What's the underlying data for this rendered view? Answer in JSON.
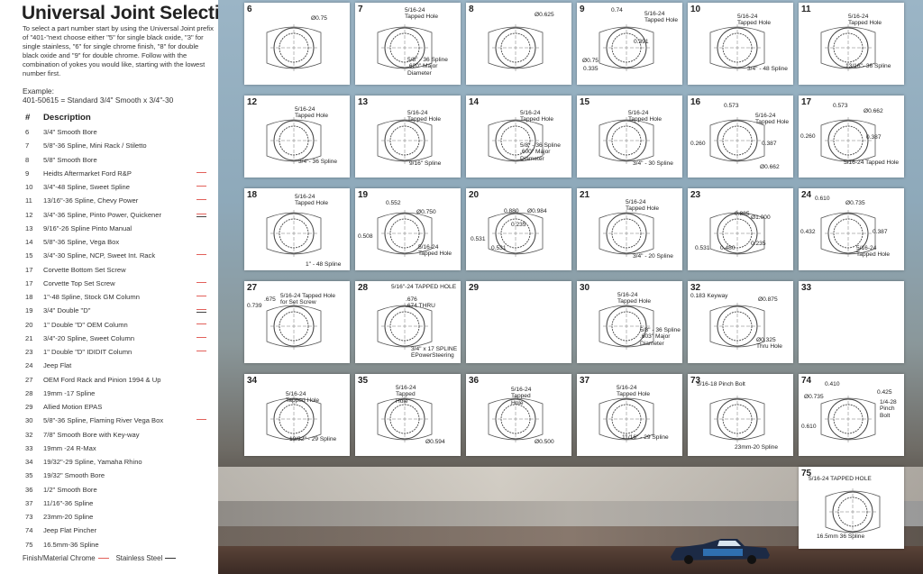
{
  "title": "Universal Joint Selection",
  "intro": "To select a part number start by using the Universal Joint prefix of \"401-\"next choose either \"5\" for single black oxide, \"3\" for single stainless, \"6\" for single chrome finish, \"8\" for double black oxide and \"9\" for double chrome. Follow with the combination of yokes you would like, starting with the lowest number first.",
  "example_label": "Example:",
  "example_value": "401-50615 = Standard 3/4\" Smooth x 3/4\"-30",
  "table_headers": {
    "num": "#",
    "desc": "Description"
  },
  "rows": [
    {
      "num": "6",
      "desc": "3/4\" Smooth Bore",
      "finish": ""
    },
    {
      "num": "7",
      "desc": "5/8\"-36 Spline, Mini Rack / Stiletto",
      "finish": ""
    },
    {
      "num": "8",
      "desc": "5/8\" Smooth Bore",
      "finish": ""
    },
    {
      "num": "9",
      "desc": "Heidts Aftermarket Ford R&P",
      "finish": "chrome"
    },
    {
      "num": "10",
      "desc": "3/4\"-48 Spline, Sweet Spline",
      "finish": "chrome"
    },
    {
      "num": "11",
      "desc": "13/16\"-36 Spline, Chevy Power",
      "finish": "chrome"
    },
    {
      "num": "12",
      "desc": "3/4\"-36 Spline, Pinto Power, Quickener",
      "finish": "both"
    },
    {
      "num": "13",
      "desc": "9/16\"-26 Spline Pinto Manual",
      "finish": ""
    },
    {
      "num": "14",
      "desc": "5/8\"-36 Spline, Vega Box",
      "finish": ""
    },
    {
      "num": "15",
      "desc": "3/4\"-30 Spline, NCP, Sweet Int. Rack",
      "finish": "chrome"
    },
    {
      "num": "17",
      "desc": "Corvette Bottom Set Screw",
      "finish": ""
    },
    {
      "num": "17",
      "desc": "Corvette Top Set Screw",
      "finish": "chrome"
    },
    {
      "num": "18",
      "desc": "1\"-48 Spline, Stock GM Column",
      "finish": "chrome"
    },
    {
      "num": "19",
      "desc": "3/4\" Double \"D\"",
      "finish": "both"
    },
    {
      "num": "20",
      "desc": "1\" Double \"D\" OEM Column",
      "finish": "chrome"
    },
    {
      "num": "21",
      "desc": "3/4\"-20 Spline, Sweet Column",
      "finish": "chrome"
    },
    {
      "num": "23",
      "desc": "1\" Double \"D\" IDIDIT Column",
      "finish": "chrome"
    },
    {
      "num": "24",
      "desc": "Jeep Flat",
      "finish": ""
    },
    {
      "num": "27",
      "desc": "OEM Ford Rack and Pinion 1994 & Up",
      "finish": ""
    },
    {
      "num": "28",
      "desc": "19mm -17 Spline",
      "finish": ""
    },
    {
      "num": "29",
      "desc": "Allied Motion EPAS",
      "finish": ""
    },
    {
      "num": "30",
      "desc": "5/8\"-36 Spline, Flaming River Vega Box",
      "finish": "chrome"
    },
    {
      "num": "32",
      "desc": "7/8\" Smooth Bore with Key-way",
      "finish": ""
    },
    {
      "num": "33",
      "desc": "19mm -24 R-Max",
      "finish": ""
    },
    {
      "num": "34",
      "desc": "19/32\"-29 Spline, Yamaha Rhino",
      "finish": ""
    },
    {
      "num": "35",
      "desc": "19/32\" Smooth Bore",
      "finish": ""
    },
    {
      "num": "36",
      "desc": "1/2\" Smooth Bore",
      "finish": ""
    },
    {
      "num": "37",
      "desc": "11/16\"-36 Spline",
      "finish": ""
    },
    {
      "num": "73",
      "desc": "23mm-20 Spline",
      "finish": ""
    },
    {
      "num": "74",
      "desc": "Jeep Flat Pincher",
      "finish": ""
    },
    {
      "num": "75",
      "desc": "16.5mm-36 Spline",
      "finish": ""
    }
  ],
  "legend": {
    "label": "Finish/Material",
    "chrome": "Chrome",
    "stainless": "Stainless Steel"
  },
  "colors": {
    "chrome": "#e2605a",
    "stainless": "#444444"
  },
  "cards": [
    {
      "num": "6",
      "notes": [
        {
          "t": "Ø0.75"
        }
      ]
    },
    {
      "num": "7",
      "notes": [
        {
          "t": "5/16-24\nTapped Hole"
        },
        {
          "t": "5/8\" - 36 Spline\n.620\" Major\nDiameter"
        }
      ]
    },
    {
      "num": "8",
      "notes": [
        {
          "t": "Ø0.625"
        }
      ]
    },
    {
      "num": "9",
      "notes": [
        {
          "t": "0.74"
        },
        {
          "t": "5/16-24\nTapped Hole"
        },
        {
          "t": "0.391"
        },
        {
          "t": "Ø0.75"
        },
        {
          "t": "0.335"
        }
      ]
    },
    {
      "num": "10",
      "notes": [
        {
          "t": "5/16-24\nTapped Hole"
        },
        {
          "t": "3/4\" - 48 Spline"
        }
      ]
    },
    {
      "num": "11",
      "notes": [
        {
          "t": "5/16-24\nTapped Hole"
        },
        {
          "t": "13/16\"- 36 Spline"
        }
      ]
    },
    {
      "num": "12",
      "notes": [
        {
          "t": "5/16-24\nTapped Hole"
        },
        {
          "t": "3/4\"- 36 Spline"
        }
      ]
    },
    {
      "num": "13",
      "notes": [
        {
          "t": "5/16-24\nTapped Hole"
        },
        {
          "t": "9/16\" Spline"
        }
      ]
    },
    {
      "num": "14",
      "notes": [
        {
          "t": "5/16-24\nTapped Hole"
        },
        {
          "t": "5/8\" - 36 Spline\n.600\" Major\nDiameter"
        }
      ]
    },
    {
      "num": "15",
      "notes": [
        {
          "t": "5/16-24\nTapped Hole"
        },
        {
          "t": "3/4\" - 30 Spline"
        }
      ]
    },
    {
      "num": "16",
      "notes": [
        {
          "t": "0.573"
        },
        {
          "t": "5/16-24\nTapped Hole"
        },
        {
          "t": "0.260"
        },
        {
          "t": "0.387"
        },
        {
          "t": "Ø0.662"
        }
      ]
    },
    {
      "num": "17",
      "notes": [
        {
          "t": "0.573"
        },
        {
          "t": "Ø0.662"
        },
        {
          "t": "0.260"
        },
        {
          "t": "0.387"
        },
        {
          "t": "5/16-24 Tapped Hole"
        }
      ]
    },
    {
      "num": "18",
      "notes": [
        {
          "t": "5/16-24\nTapped Hole"
        },
        {
          "t": "1\" - 48 Spline"
        }
      ]
    },
    {
      "num": "19",
      "notes": [
        {
          "t": "0.552"
        },
        {
          "t": "Ø0.750"
        },
        {
          "t": "0.508"
        },
        {
          "t": "5/16-24\nTapped Hole"
        }
      ]
    },
    {
      "num": "20",
      "notes": [
        {
          "t": "0.880"
        },
        {
          "t": "Ø0.984"
        },
        {
          "t": "0.235"
        },
        {
          "t": "0.531"
        },
        {
          "t": "0.531"
        }
      ]
    },
    {
      "num": "21",
      "notes": [
        {
          "t": "5/16-24\nTapped Hole"
        },
        {
          "t": "3/4\" - 20 Spline"
        }
      ]
    },
    {
      "num": "23",
      "notes": [
        {
          "t": "0.885"
        },
        {
          "t": "Ø1.000"
        },
        {
          "t": "0.235"
        },
        {
          "t": "0.531"
        },
        {
          "t": "0.480"
        }
      ]
    },
    {
      "num": "24",
      "notes": [
        {
          "t": "0.610"
        },
        {
          "t": "Ø0.735"
        },
        {
          "t": "0.432"
        },
        {
          "t": "0.387"
        },
        {
          "t": "5/16-24\nTapped Hole"
        }
      ]
    },
    {
      "num": "27",
      "notes": [
        {
          "t": ".675"
        },
        {
          "t": "5/16-24 Tapped Hole\nfor Set Screw"
        },
        {
          "t": "0.739"
        }
      ]
    },
    {
      "num": "28",
      "notes": [
        {
          "t": "5/16\"-24 TAPPED HOLE"
        },
        {
          "t": ".676\n.674 THRU"
        },
        {
          "t": "3/4\" x 17 SPLINE\nEPowerSteering"
        }
      ]
    },
    {
      "num": "29",
      "notes": []
    },
    {
      "num": "30",
      "notes": [
        {
          "t": "5/16-24\nTapped Hole"
        },
        {
          "t": "5/8\" - 36 Spline\n.603\" Major\nDiameter"
        }
      ]
    },
    {
      "num": "32",
      "notes": [
        {
          "t": "0.183 Keyway"
        },
        {
          "t": "Ø0.875"
        },
        {
          "t": "Ø0.325\nThru Hole"
        }
      ]
    },
    {
      "num": "33",
      "notes": []
    },
    {
      "num": "34",
      "notes": [
        {
          "t": "5/16-24\nTapped Hole"
        },
        {
          "t": "19/32\" - 29 Spline"
        }
      ]
    },
    {
      "num": "35",
      "notes": [
        {
          "t": "5/16-24\nTapped\nHole"
        },
        {
          "t": "Ø0.594"
        }
      ]
    },
    {
      "num": "36",
      "notes": [
        {
          "t": "5/16-24\nTapped\nHole"
        },
        {
          "t": "Ø0.500"
        }
      ]
    },
    {
      "num": "37",
      "notes": [
        {
          "t": "5/16-24\nTapped Hole"
        },
        {
          "t": "11/16\" - 29 Spline"
        }
      ]
    },
    {
      "num": "73",
      "notes": [
        {
          "t": "5/16-18 Pinch Bolt"
        },
        {
          "t": "23mm-20 Spline"
        }
      ]
    },
    {
      "num": "74",
      "notes": [
        {
          "t": "0.410"
        },
        {
          "t": "Ø0.735"
        },
        {
          "t": "0.425"
        },
        {
          "t": "1/4-28\nPinch\nBolt"
        },
        {
          "t": "0.610"
        }
      ]
    },
    {
      "num": "75",
      "notes": [
        {
          "t": "5/16-24 TAPPED HOLE"
        },
        {
          "t": "16.5mm 36 Spline"
        }
      ]
    }
  ]
}
